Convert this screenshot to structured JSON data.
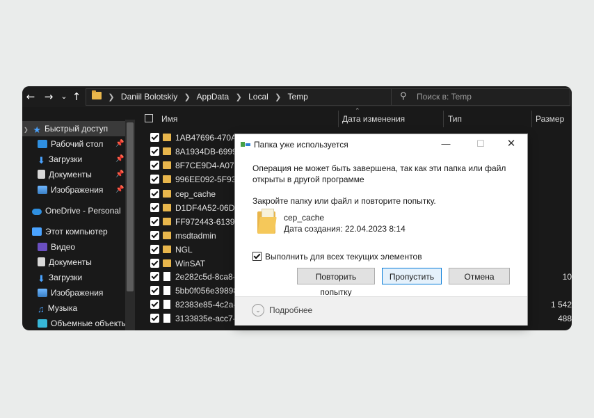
{
  "explorer": {
    "breadcrumb": [
      "Daniil Bolotskiy",
      "AppData",
      "Local",
      "Temp"
    ],
    "search_placeholder": "Поиск в: Temp",
    "sidebar": [
      {
        "label": "Быстрый доступ",
        "icon": "star-icon",
        "pinned": false
      },
      {
        "label": "Рабочий стол",
        "icon": "desktop-icon",
        "pinned": true
      },
      {
        "label": "Загрузки",
        "icon": "download-icon",
        "pinned": true
      },
      {
        "label": "Документы",
        "icon": "documents-icon",
        "pinned": true
      },
      {
        "label": "Изображения",
        "icon": "pictures-icon",
        "pinned": true
      },
      {
        "label": "OneDrive - Personal",
        "icon": "cloud-icon",
        "pinned": false
      },
      {
        "label": "Этот компьютер",
        "icon": "computer-icon",
        "pinned": false
      },
      {
        "label": "Видео",
        "icon": "video-icon",
        "pinned": false
      },
      {
        "label": "Документы",
        "icon": "documents-icon",
        "pinned": false
      },
      {
        "label": "Загрузки",
        "icon": "download-icon",
        "pinned": false
      },
      {
        "label": "Изображения",
        "icon": "pictures-icon",
        "pinned": false
      },
      {
        "label": "Музыка",
        "icon": "music-icon",
        "pinned": false
      },
      {
        "label": "Объемные объекты",
        "icon": "3d-objects-icon",
        "pinned": false
      }
    ],
    "columns": {
      "name": "Имя",
      "date": "Дата изменения",
      "type": "Тип",
      "size": "Размер"
    },
    "files": [
      {
        "name": "1AB47696-470A-4",
        "kind": "folder",
        "size": ""
      },
      {
        "name": "8A1934DB-6999-4",
        "kind": "folder",
        "size": ""
      },
      {
        "name": "8F7CE9D4-A078-4",
        "kind": "folder",
        "size": ""
      },
      {
        "name": "996EE092-5F93-4",
        "kind": "folder",
        "size": ""
      },
      {
        "name": "cep_cache",
        "kind": "folder",
        "size": ""
      },
      {
        "name": "D1DF4A52-06DF-",
        "kind": "folder",
        "size": ""
      },
      {
        "name": "FF972443-6139-4",
        "kind": "folder",
        "size": ""
      },
      {
        "name": "msdtadmin",
        "kind": "folder",
        "size": ""
      },
      {
        "name": "NGL",
        "kind": "folder",
        "size": ""
      },
      {
        "name": "WinSAT",
        "kind": "folder",
        "size": ""
      },
      {
        "name": "2e282c5d-8ca8-4a",
        "kind": "file",
        "size": "10"
      },
      {
        "name": "5bb0f056e398983",
        "kind": "file",
        "size": ""
      },
      {
        "name": "82383e85-4c2a-4",
        "kind": "file",
        "size": "1 542"
      },
      {
        "name": "3133835e-acc7-4a",
        "kind": "file",
        "size": "488"
      }
    ]
  },
  "dialog": {
    "title": "Папка уже используется",
    "message_line1": "Операция не может быть завершена, так как эти папка или файл",
    "message_line2": "открыты в другой программе",
    "instruction": "Закройте папку или файл и повторите попытку.",
    "item_name": "cep_cache",
    "item_created": "Дата создания: 22.04.2023 8:14",
    "apply_all_label": "Выполнить для всех текущих элементов",
    "apply_all_checked": true,
    "buttons": {
      "retry": "Повторить попытку",
      "skip": "Пропустить",
      "cancel": "Отмена"
    },
    "details_label": "Подробнее"
  },
  "colors": {
    "explorer_bg": "#191919",
    "folder": "#e8b64c",
    "accent": "#0078d7"
  }
}
